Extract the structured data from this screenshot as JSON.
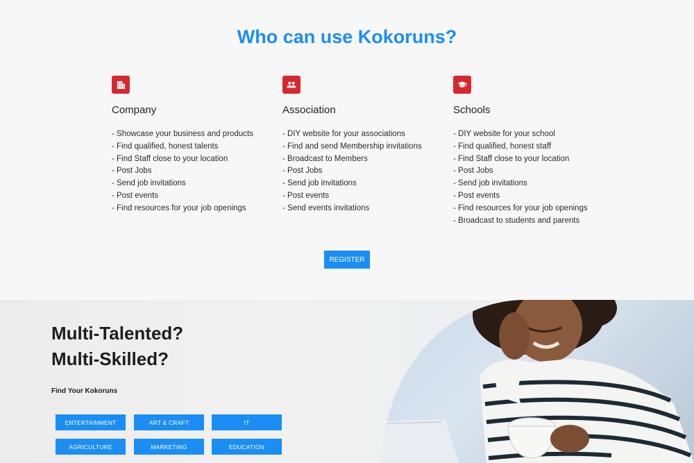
{
  "who_section": {
    "title": "Who can use Kokoruns?",
    "columns": [
      {
        "icon": "building-icon",
        "heading": "Company",
        "items": [
          "- Showcase your business and products",
          "- Find qualified, honest talents",
          "- Find Staff close to your location",
          "- Post Jobs",
          "- Send job invitations",
          "- Post events",
          "- Find resources for your job openings"
        ]
      },
      {
        "icon": "people-icon",
        "heading": "Association",
        "items": [
          "- DIY website for your associations",
          "- Find and send Membership invitations",
          "- Broadcast to Members",
          "- Post Jobs",
          "- Send job invitations",
          "- Post events",
          "- Send events invitations"
        ]
      },
      {
        "icon": "graduation-cap-icon",
        "heading": "Schools",
        "items": [
          "- DIY website for your school",
          "- Find qualified, honest staff",
          "- Find Staff close to your location",
          "- Post Jobs",
          "- Send job invitations",
          "- Post events",
          "- Find resources for your job openings",
          "- Broadcast to students and parents"
        ]
      }
    ],
    "register_label": "REGISTER"
  },
  "talent_section": {
    "title_line1": "Multi-Talented?",
    "title_line2": "Multi-Skilled?",
    "subtitle": "Find Your Kokoruns",
    "categories": [
      "ENTERTAINMENT",
      "ART & CRAFT",
      "IT",
      "AGRICULTURE",
      "MARKETING",
      "EDUCATION"
    ]
  },
  "colors": {
    "accent": "#1a8ef5",
    "icon_bg": "#d7282f"
  }
}
